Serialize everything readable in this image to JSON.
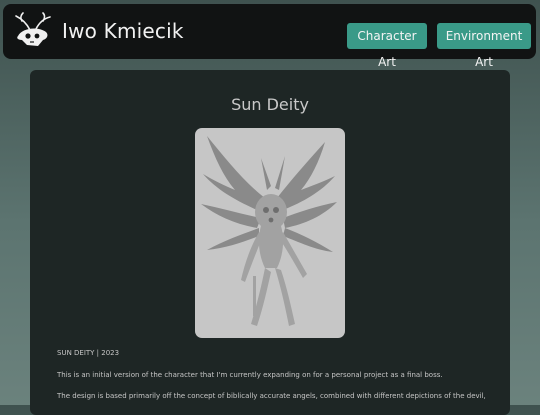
{
  "header": {
    "site_title": "Iwo Kmiecik",
    "nav": {
      "character_art": "Character Art",
      "environment_art": "Environment Art"
    }
  },
  "project": {
    "title": "Sun Deity",
    "meta": "SUN DEITY | 2023",
    "paragraphs": [
      "This is an initial version of the character that I'm currently expanding on for a personal project as a final boss.",
      "The design is based primarily off the concept of biblically accurate angels, combined with different depictions of the devil,"
    ]
  },
  "colors": {
    "accent": "#3a9a88",
    "header_bg": "#111313",
    "card_bg": "#1e2625"
  }
}
